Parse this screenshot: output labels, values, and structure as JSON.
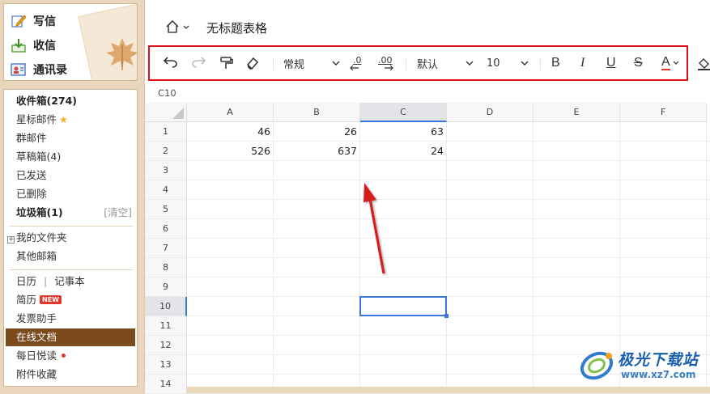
{
  "mail": {
    "compose_label": "写信",
    "inbox_label": "收信",
    "contacts_label": "通讯录",
    "folders": {
      "inbox": "收件箱(274)",
      "starred": "星标邮件",
      "group": "群邮件",
      "drafts": "草稿箱(4)",
      "sent": "已发送",
      "deleted": "已删除",
      "trash": "垃圾箱(1)",
      "trash_clear": "[清空]",
      "my_folders": "我的文件夹",
      "other_mailboxes": "其他邮箱",
      "calendar": "日历",
      "divider": "|",
      "notes": "记事本",
      "resume": "简历",
      "new_badge": "NEW",
      "invoice": "发票助手",
      "online_docs": "在线文档",
      "daily_read": "每日悦读",
      "attachments": "附件收藏"
    }
  },
  "document": {
    "title": "无标题表格"
  },
  "toolbar": {
    "number_format": "常规",
    "font_family": "默认",
    "font_size": "10",
    "bold": "B",
    "italic": "I",
    "underline": "U",
    "strike": "S",
    "font_color": "A",
    "decrease_decimal": ".0",
    "increase_decimal": ".00"
  },
  "sheet": {
    "name_box": "C10",
    "columns": [
      "A",
      "B",
      "C",
      "D",
      "E",
      "F"
    ],
    "rows": [
      "1",
      "2",
      "3",
      "4",
      "5",
      "6",
      "7",
      "8",
      "9",
      "10",
      "11",
      "12",
      "13",
      "14"
    ],
    "selected_column": "C",
    "selected_row": "10",
    "cells": {
      "A1": "46",
      "B1": "26",
      "C1": "63",
      "A2": "526",
      "B2": "637",
      "C2": "24"
    }
  },
  "watermark": {
    "name": "极光下载站",
    "url": "www.xz7.com"
  },
  "colors": {
    "sidebar_bg": "#e9d6bd",
    "active_folder": "#7b4a1d",
    "highlight_box": "#e0101b",
    "selection": "#3a78d8",
    "arrow": "#d81e1e"
  }
}
